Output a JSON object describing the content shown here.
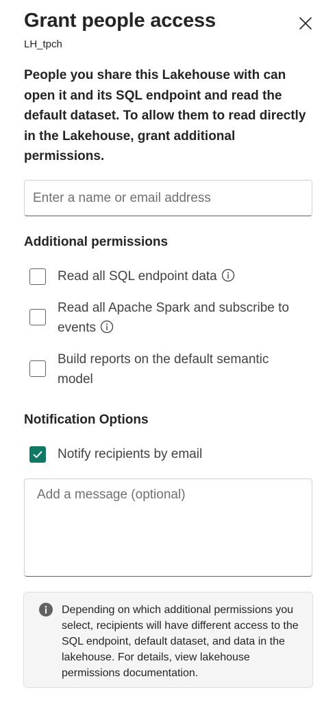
{
  "dialog": {
    "title": "Grant people access",
    "subtitle": "LH_tpch",
    "intro": "People you share this Lakehouse with can open it and its SQL endpoint and read the default dataset. To allow them to read directly in the Lakehouse, grant additional permissions."
  },
  "search": {
    "placeholder": "Enter a name or email address",
    "value": ""
  },
  "additional_permissions": {
    "heading": "Additional permissions",
    "items": [
      {
        "label": "Read all SQL endpoint data",
        "checked": false,
        "info_icon": "info-icon"
      },
      {
        "label": "Read all Apache Spark and subscribe to events",
        "checked": false,
        "info_icon": "info-icon"
      },
      {
        "label": "Build reports on the default semantic model",
        "checked": false
      }
    ]
  },
  "notification": {
    "heading": "Notification Options",
    "notify_label": "Notify recipients by email",
    "notify_checked": true,
    "message_placeholder": "Add a message (optional)",
    "message_value": ""
  },
  "notice": {
    "icon": "info-filled-icon",
    "text": "Depending on which additional permissions you select, recipients will have different access to the SQL endpoint, default dataset, and data in the lakehouse. For details, view lakehouse permissions documentation."
  },
  "colors": {
    "accent": "#117865",
    "text": "#242424",
    "muted": "#424242",
    "notice_bg": "#f5f5f5"
  },
  "icons": {
    "close": "close-icon",
    "check": "checkmark-icon"
  }
}
